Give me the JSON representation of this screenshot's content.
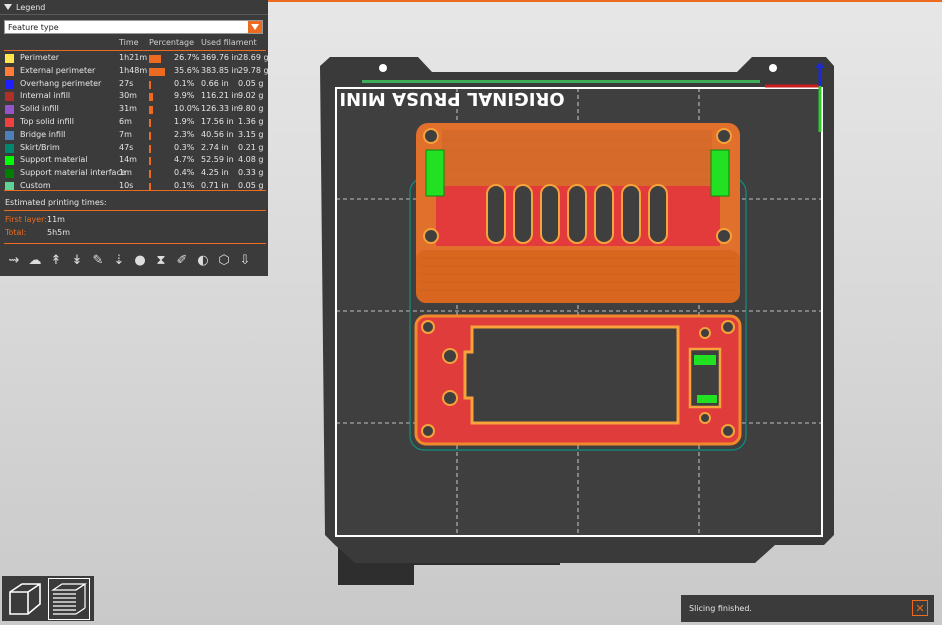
{
  "legend": {
    "title": "Legend",
    "view_select": "Feature type",
    "columns": [
      "Time",
      "Percentage",
      "Used filament"
    ],
    "rows": [
      {
        "name": "Perimeter",
        "color": "#ffe64d",
        "time": "1h21m",
        "pct": "26.7%",
        "len": "369.76 in",
        "weight": "28.69 g",
        "bar": 26.7
      },
      {
        "name": "External perimeter",
        "color": "#ff7d38",
        "time": "1h48m",
        "pct": "35.6%",
        "len": "383.85 in",
        "weight": "29.78 g",
        "bar": 35.6
      },
      {
        "name": "Overhang perimeter",
        "color": "#1f1fff",
        "time": "27s",
        "pct": "0.1%",
        "len": "0.66 in",
        "weight": "0.05 g",
        "bar": 0.1
      },
      {
        "name": "Internal infill",
        "color": "#b03029",
        "time": "30m",
        "pct": "9.9%",
        "len": "116.21 in",
        "weight": "9.02 g",
        "bar": 9.9
      },
      {
        "name": "Solid infill",
        "color": "#9654cc",
        "time": "31m",
        "pct": "10.0%",
        "len": "126.33 in",
        "weight": "9.80 g",
        "bar": 10.0
      },
      {
        "name": "Top solid infill",
        "color": "#f04040",
        "time": "6m",
        "pct": "1.9%",
        "len": "17.56 in",
        "weight": "1.36 g",
        "bar": 1.9
      },
      {
        "name": "Bridge infill",
        "color": "#4d80ba",
        "time": "7m",
        "pct": "2.3%",
        "len": "40.56 in",
        "weight": "3.15 g",
        "bar": 2.3
      },
      {
        "name": "Skirt/Brim",
        "color": "#00876e",
        "time": "47s",
        "pct": "0.3%",
        "len": "2.74 in",
        "weight": "0.21 g",
        "bar": 0.3
      },
      {
        "name": "Support material",
        "color": "#00ff00",
        "time": "14m",
        "pct": "4.7%",
        "len": "52.59 in",
        "weight": "4.08 g",
        "bar": 4.7
      },
      {
        "name": "Support material interface",
        "color": "#008000",
        "time": "1m",
        "pct": "0.4%",
        "len": "4.25 in",
        "weight": "0.33 g",
        "bar": 0.4
      },
      {
        "name": "Custom",
        "color": "#5ed194",
        "time": "10s",
        "pct": "0.1%",
        "len": "0.71 in",
        "weight": "0.05 g",
        "bar": 0.1
      }
    ],
    "estimated_label": "Estimated printing times:",
    "first_layer_label": "First layer:",
    "first_layer_value": "11m",
    "total_label": "Total:",
    "total_value": "5h5m"
  },
  "toolbar_icons": [
    "travel-icon",
    "wipe-icon",
    "retractions-icon",
    "deretractions-icon",
    "seams-icon",
    "tool-changes-icon",
    "color-changes-icon",
    "pause-prints-icon",
    "custom-gcodes-icon",
    "center-of-gravity-icon",
    "shells-icon",
    "tool-marker-icon"
  ],
  "bed": {
    "logo_text": "ORIGINAL PRUSA MINI"
  },
  "view_buttons": [
    "3d-view-icon",
    "preview-layers-icon"
  ],
  "notification": {
    "text": "Slicing finished."
  },
  "colors": {
    "accent": "#ed6b21",
    "panel": "#3b3b3b",
    "bed": "#3d3d3d"
  }
}
